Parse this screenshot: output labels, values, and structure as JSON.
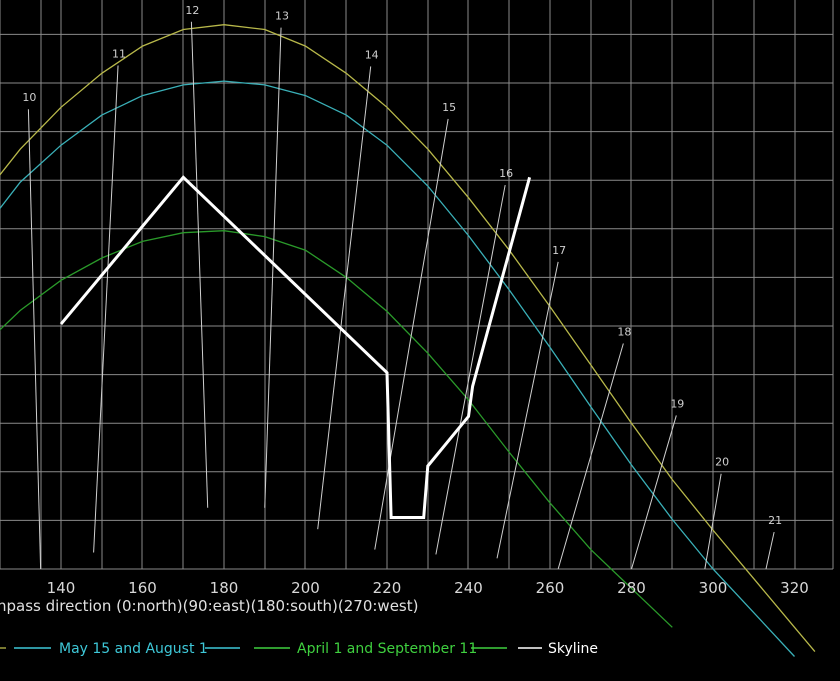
{
  "chart_data": {
    "type": "line",
    "title": "",
    "xlabel": "npass direction (0:north)(90:east)(180:south)(270:west)",
    "ylabel": "",
    "xlim": [
      123,
      325
    ],
    "ylim": [
      0,
      58
    ],
    "x_ticks": [
      140,
      160,
      180,
      200,
      220,
      240,
      260,
      280,
      300,
      320
    ],
    "grid": true,
    "colors": {
      "background": "#000000",
      "grid": "#8a8a8a",
      "summer": "#b8b84a",
      "may_aug": "#3ab0b8",
      "apr_sep": "#2a9a2a",
      "hour_lines": "#d0d0d0",
      "skyline": "#ffffff",
      "legend_may_aug": "#3ec8d8",
      "legend_apr_sep": "#3fd03f",
      "legend_skyline": "#ffffff"
    },
    "series": [
      {
        "key": "summer",
        "x": [
          123,
          130,
          140,
          150,
          160,
          170,
          180,
          190,
          200,
          210,
          220,
          230,
          240,
          250,
          260,
          270,
          280,
          290,
          300,
          310,
          320,
          325
        ],
        "y": [
          39.5,
          43.2,
          47.5,
          51.0,
          53.8,
          55.5,
          56.0,
          55.5,
          53.8,
          51.0,
          47.5,
          43.2,
          38.2,
          32.8,
          27.0,
          21.0,
          15.0,
          9.2,
          4.0,
          -1.0,
          -6.0,
          -8.5
        ]
      },
      {
        "key": "may_aug",
        "x": [
          123,
          130,
          140,
          150,
          160,
          170,
          180,
          190,
          200,
          210,
          220,
          230,
          240,
          250,
          260,
          270,
          280,
          290,
          300,
          310,
          320
        ],
        "y": [
          36.0,
          39.8,
          43.6,
          46.7,
          48.7,
          49.8,
          50.2,
          49.8,
          48.7,
          46.7,
          43.6,
          39.4,
          34.3,
          28.7,
          22.8,
          16.7,
          10.7,
          5.1,
          0.0,
          -4.5,
          -9.0
        ]
      },
      {
        "key": "apr_sep",
        "x": [
          123,
          130,
          140,
          150,
          160,
          170,
          180,
          190,
          200,
          210,
          220,
          230,
          240,
          250,
          260,
          270,
          280,
          290
        ],
        "y": [
          23.8,
          26.6,
          29.7,
          32.0,
          33.7,
          34.6,
          34.8,
          34.2,
          32.8,
          30.0,
          26.5,
          22.2,
          17.4,
          12.0,
          6.8,
          2.0,
          -2.0,
          -6.0
        ]
      },
      {
        "key": "skyline",
        "x": [
          140,
          170,
          220,
          221,
          229,
          230,
          240,
          241,
          255
        ],
        "y": [
          25.2,
          40.3,
          20.2,
          5.3,
          5.3,
          10.6,
          15.7,
          18.8,
          40.3
        ]
      }
    ],
    "hour_lines": [
      {
        "label": "10",
        "top": [
          132,
          47.3
        ],
        "bottom": [
          135,
          0
        ]
      },
      {
        "label": "11",
        "top": [
          154,
          51.8
        ],
        "bottom": [
          148,
          1.7
        ]
      },
      {
        "label": "12",
        "top": [
          172,
          56.3
        ],
        "bottom": [
          176,
          6.3
        ]
      },
      {
        "label": "13",
        "top": [
          194,
          55.7
        ],
        "bottom": [
          190,
          6.3
        ]
      },
      {
        "label": "14",
        "top": [
          216,
          51.7
        ],
        "bottom": [
          203,
          4.1
        ]
      },
      {
        "label": "15",
        "top": [
          235,
          46.3
        ],
        "bottom": [
          217,
          2.0
        ]
      },
      {
        "label": "16",
        "top": [
          249,
          39.5
        ],
        "bottom": [
          232,
          1.5
        ]
      },
      {
        "label": "17",
        "top": [
          262,
          31.6
        ],
        "bottom": [
          247,
          1.1
        ]
      },
      {
        "label": "18",
        "top": [
          278,
          23.2
        ],
        "bottom": [
          262,
          0
        ]
      },
      {
        "label": "19",
        "top": [
          291,
          15.8
        ],
        "bottom": [
          280,
          0
        ]
      },
      {
        "label": "20",
        "top": [
          302,
          9.8
        ],
        "bottom": [
          298,
          0
        ]
      },
      {
        "label": "21",
        "top": [
          315,
          3.8
        ],
        "bottom": [
          313,
          0
        ]
      }
    ],
    "legend": {
      "placement": "bottom",
      "entries": [
        {
          "label": "May 15 and August 1",
          "color": "#3ec8d8"
        },
        {
          "label": "April 1 and September 11",
          "color": "#3fd03f"
        },
        {
          "label": "Skyline",
          "color": "#ffffff"
        }
      ]
    }
  }
}
